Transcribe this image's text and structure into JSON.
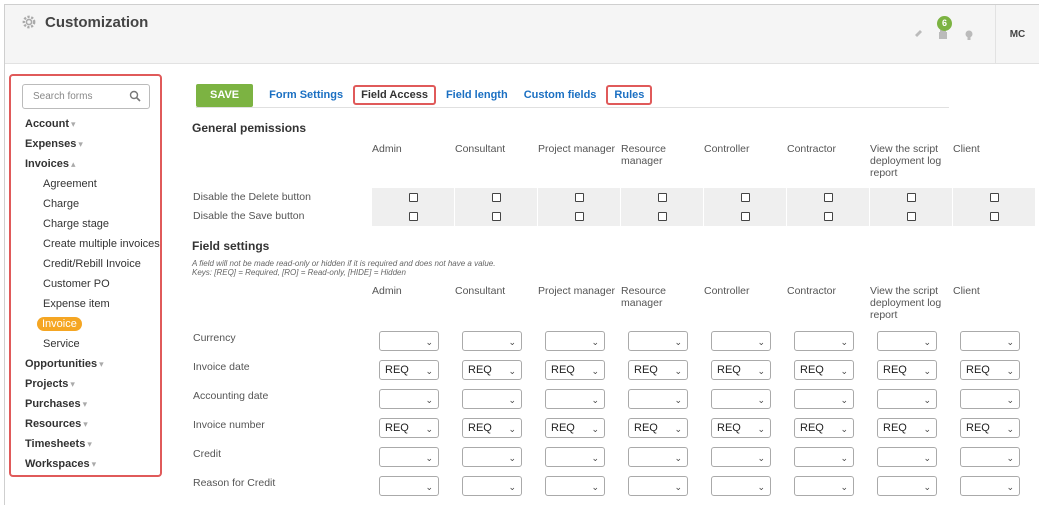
{
  "header": {
    "title": "Customization",
    "badge_count": "6",
    "avatar_initials": "MC"
  },
  "sidebar": {
    "search_placeholder": "Search forms",
    "sections": [
      {
        "label": "Account",
        "chev": "▾"
      },
      {
        "label": "Expenses",
        "chev": "▾"
      },
      {
        "label": "Invoices",
        "chev": "▴"
      },
      {
        "label": "Opportunities",
        "chev": "▾"
      },
      {
        "label": "Projects",
        "chev": "▾"
      },
      {
        "label": "Purchases",
        "chev": "▾"
      },
      {
        "label": "Resources",
        "chev": "▾"
      },
      {
        "label": "Timesheets",
        "chev": "▾"
      },
      {
        "label": "Workspaces",
        "chev": "▾"
      }
    ],
    "invoice_items": [
      "Agreement",
      "Charge",
      "Charge stage",
      "Create multiple invoices",
      "Credit/Rebill Invoice",
      "Customer PO",
      "Expense item",
      "Invoice",
      "Service"
    ],
    "active_item": "Invoice"
  },
  "toolbar": {
    "save_label": "SAVE",
    "tabs": [
      "Form Settings",
      "Field Access",
      "Field length",
      "Custom fields",
      "Rules"
    ]
  },
  "general": {
    "title": "General pemissions",
    "columns": [
      "Admin",
      "Consultant",
      "Project manager",
      "Resource manager",
      "Controller",
      "Contractor",
      "View the script deployment log report",
      "Client"
    ],
    "rows": [
      "Disable the Delete button",
      "Disable the Save button"
    ]
  },
  "fields": {
    "title": "Field settings",
    "note_line1": "A field will not be made read-only or hidden if it is required and does not have a value.",
    "note_line2": "Keys: [REQ] = Required, [RO] = Read-only, [HIDE] = Hidden",
    "columns": [
      "Admin",
      "Consultant",
      "Project manager",
      "Resource manager",
      "Controller",
      "Contractor",
      "View the script deployment log report",
      "Client"
    ],
    "rows": [
      {
        "label": "Currency",
        "value": ""
      },
      {
        "label": "Invoice date",
        "value": "REQ"
      },
      {
        "label": "Accounting date",
        "value": ""
      },
      {
        "label": "Invoice number",
        "value": "REQ"
      },
      {
        "label": "Credit",
        "value": ""
      },
      {
        "label": "Reason for Credit",
        "value": ""
      }
    ]
  },
  "colors": {
    "accent_green": "#7cb342",
    "link_blue": "#1a6fc2",
    "highlight_red": "#e05a5a",
    "active_orange": "#f5a623"
  }
}
